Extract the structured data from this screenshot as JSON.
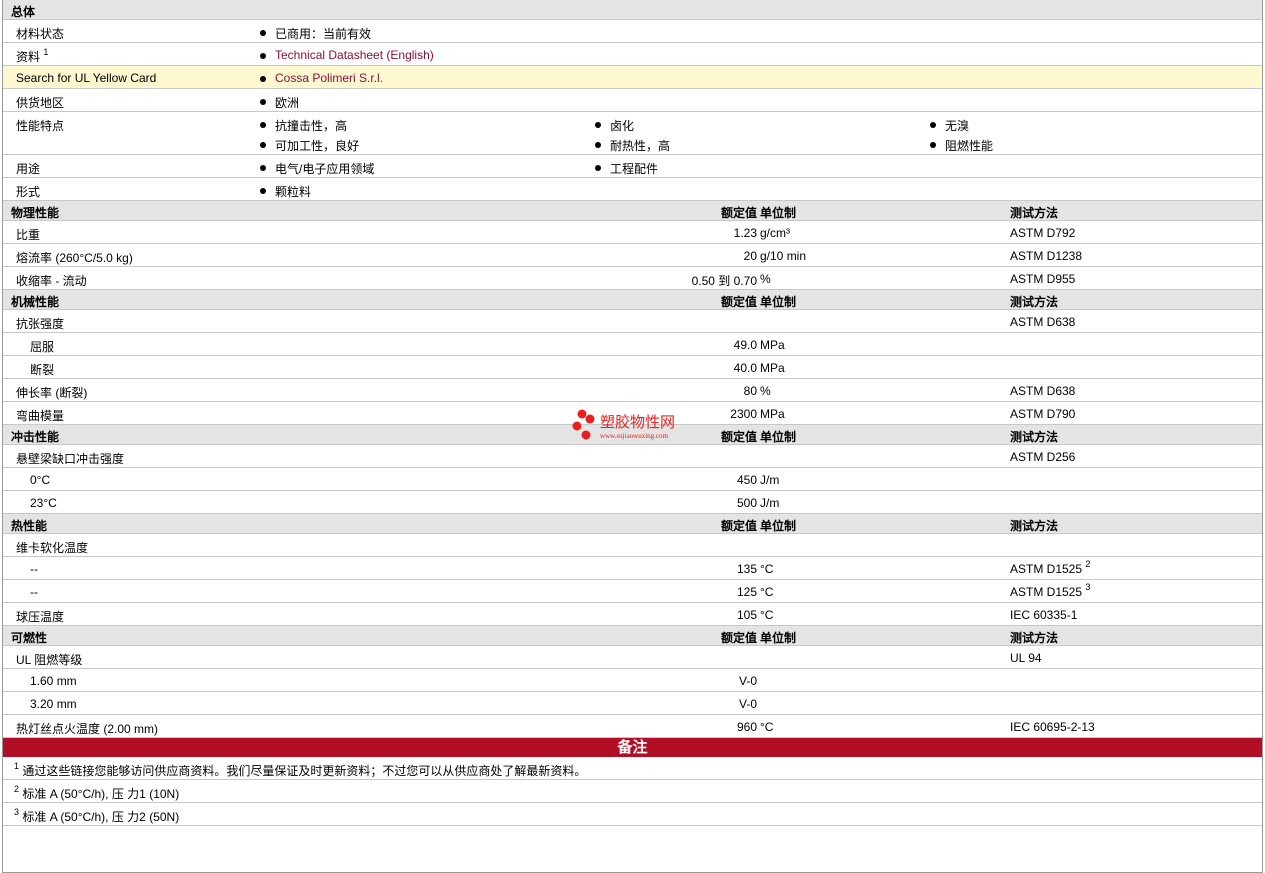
{
  "general": {
    "title": "总体",
    "rows": [
      {
        "label": "材料状态",
        "values": [
          "已商用：当前有效"
        ]
      },
      {
        "label": "资料",
        "sup": "1",
        "values": [
          "Technical Datasheet (English)"
        ],
        "link": true
      },
      {
        "label": "Search for UL Yellow Card",
        "values": [
          "Cossa Polimeri S.r.l."
        ],
        "link": true,
        "highlight": true
      },
      {
        "label": "供货地区",
        "values": [
          "欧洲"
        ]
      },
      {
        "label": "性能特点",
        "values": [
          "抗撞击性，高",
          "卤化",
          "无溴",
          "可加工性，良好",
          "耐热性，高",
          "阻燃性能"
        ]
      },
      {
        "label": "用途",
        "values": [
          "电气/电子应用领域",
          "工程配件"
        ]
      },
      {
        "label": "形式",
        "values": [
          "颗粒料"
        ]
      }
    ]
  },
  "columns": {
    "nominal": "额定值",
    "unit": "单位制",
    "method": "测试方法"
  },
  "sections": [
    {
      "title": "物理性能",
      "rows": [
        {
          "label": "比重",
          "value": "1.23",
          "unit": "g/cm³",
          "method": "ASTM D792"
        },
        {
          "label": "熔流率  (260°C/5.0 kg)",
          "value": "20",
          "unit": "g/10 min",
          "method": "ASTM D1238"
        },
        {
          "label": "收缩率  - 流动",
          "value": "0.50 到  0.70",
          "unit": "%",
          "method": "ASTM D955"
        }
      ]
    },
    {
      "title": "机械性能",
      "rows": [
        {
          "label": "抗张强度",
          "value": "",
          "unit": "",
          "method": "ASTM D638"
        },
        {
          "label": "屈服",
          "indent": true,
          "value": "49.0",
          "unit": "MPa",
          "method": ""
        },
        {
          "label": "断裂",
          "indent": true,
          "value": "40.0",
          "unit": "MPa",
          "method": ""
        },
        {
          "label": "伸长率  (断裂)",
          "value": "80",
          "unit": "%",
          "method": "ASTM D638"
        },
        {
          "label": "弯曲模量",
          "value": "2300",
          "unit": "MPa",
          "method": "ASTM D790"
        }
      ]
    },
    {
      "title": "冲击性能",
      "rows": [
        {
          "label": "悬壁梁缺口冲击强度",
          "value": "",
          "unit": "",
          "method": "ASTM D256"
        },
        {
          "label": "0°C",
          "indent": true,
          "value": "450",
          "unit": "J/m",
          "method": ""
        },
        {
          "label": "23°C",
          "indent": true,
          "value": "500",
          "unit": "J/m",
          "method": ""
        }
      ]
    },
    {
      "title": "热性能",
      "rows": [
        {
          "label": "维卡软化温度",
          "value": "",
          "unit": "",
          "method": ""
        },
        {
          "label": "--",
          "indent": true,
          "value": "135",
          "unit": "°C",
          "method": "ASTM D1525",
          "sup": "2"
        },
        {
          "label": "--",
          "indent": true,
          "value": "125",
          "unit": "°C",
          "method": "ASTM D1525",
          "sup": "3"
        },
        {
          "label": "球压温度",
          "value": "105",
          "unit": "°C",
          "method": "IEC 60335-1"
        }
      ]
    },
    {
      "title": "可燃性",
      "rows": [
        {
          "label": "UL 阻燃等级",
          "value": "",
          "unit": "",
          "method": "UL 94"
        },
        {
          "label": "1.60 mm",
          "indent": true,
          "value": "V-0",
          "unit": "",
          "method": ""
        },
        {
          "label": "3.20 mm",
          "indent": true,
          "value": "V-0",
          "unit": "",
          "method": ""
        },
        {
          "label": "热灯丝点火温度  (2.00 mm)",
          "value": "960",
          "unit": "°C",
          "method": "IEC 60695-2-13"
        }
      ]
    }
  ],
  "notes": {
    "title": "备注",
    "items": [
      {
        "sup": "1",
        "text": "通过这些链接您能够访问供应商资料。我们尽量保证及时更新资料；不过您可以从供应商处了解最新资料。"
      },
      {
        "sup": "2",
        "text": "标准  A (50°C/h), 压  力1 (10N)"
      },
      {
        "sup": "3",
        "text": "标准  A (50°C/h), 压  力2 (50N)"
      }
    ]
  },
  "watermark": {
    "text": "塑胶物性网",
    "url": "www.sujiaowuxing.com"
  },
  "colors": {
    "link": "#8b0f3c",
    "notes_header": "#b20f27",
    "highlight": "#fdf8d0",
    "section_bg": "#e4e4e4"
  }
}
